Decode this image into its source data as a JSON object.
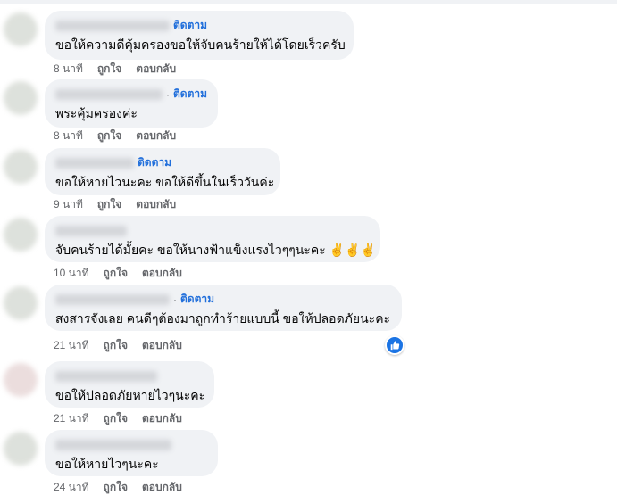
{
  "comments": [
    {
      "follow": "ติดตาม",
      "text": "ขอให้ความดีคุ้มครองขอให้จับคนร้ายให้ได้โดยเร็วครับ",
      "time": "8 นาที",
      "like": "ถูกใจ",
      "reply": "ตอบกลับ"
    },
    {
      "follow": "ติดตาม",
      "text": "พระคุ้มครองค่ะ",
      "time": "8 นาที",
      "like": "ถูกใจ",
      "reply": "ตอบกลับ"
    },
    {
      "follow": "ติดตาม",
      "text": "ขอให้หายไวนะคะ ขอให้ดีขึ้นในเร็ววันค่ะ",
      "time": "9 นาที",
      "like": "ถูกใจ",
      "reply": "ตอบกลับ"
    },
    {
      "follow": "",
      "text": "จับคนร้ายได้มั้ยคะ ขอให้นางฟ้าแข็งแรงไวๆๆนะคะ ✌️✌️✌️",
      "time": "10 นาที",
      "like": "ถูกใจ",
      "reply": "ตอบกลับ"
    },
    {
      "follow": "ติดตาม",
      "text": "สงสารจังเลย คนดีๆต้องมาถูกทำร้ายแบบนี้ ขอให้ปลอดภัยนะคะ",
      "time": "21 นาที",
      "like": "ถูกใจ",
      "reply": "ตอบกลับ",
      "reaction": "like-icon"
    },
    {
      "follow": "",
      "text": "ขอให้ปลอดภัยหายไวๆนะคะ",
      "time": "21 นาที",
      "like": "ถูกใจ",
      "reply": "ตอบกลับ"
    },
    {
      "follow": "",
      "text": "ขอให้หายไวๆนะคะ",
      "time": "24 นาที",
      "like": "ถูกใจ",
      "reply": "ตอบกลับ"
    }
  ],
  "colors": {
    "bubble": "#f0f2f5",
    "follow": "#216fdb",
    "meta": "#65676b",
    "text": "#050505",
    "like_reaction": "#1b74e4"
  }
}
